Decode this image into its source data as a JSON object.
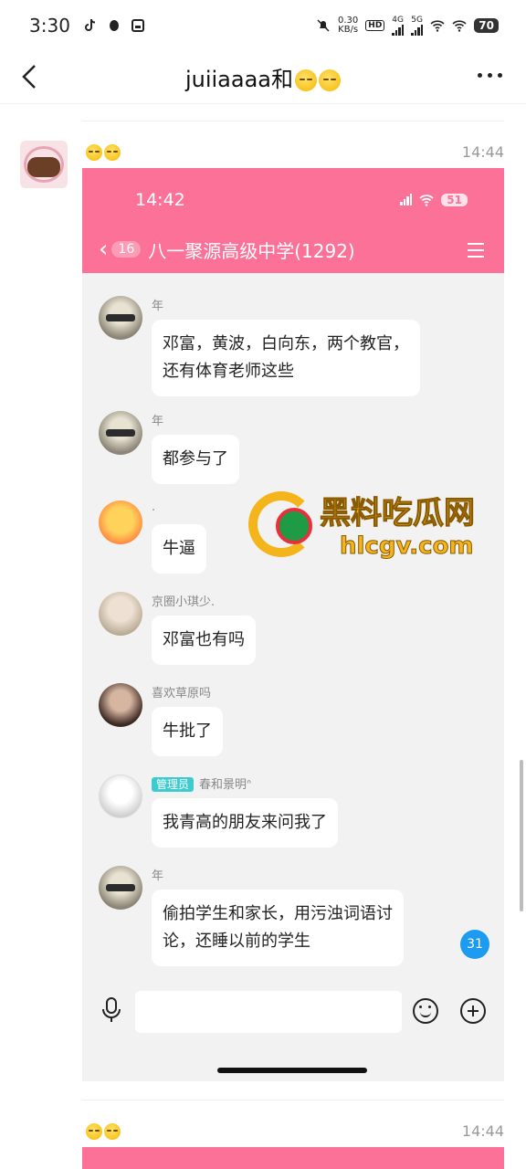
{
  "status_bar": {
    "time": "3:30",
    "net_speed_value": "0.30",
    "net_speed_unit": "KB/s",
    "hd": "HD",
    "sig1": "4G",
    "sig2": "5G",
    "battery": "70"
  },
  "header": {
    "title": "juiiaaaa和"
  },
  "messages": [
    {
      "timestamp": "14:44"
    }
  ],
  "screenshot": {
    "time": "14:42",
    "battery": "51",
    "badge": "16",
    "group_name": "八一聚源高级中学(1292)",
    "chat": [
      {
        "name": "年",
        "text_line1": "邓富，黄波，白向东，两个教官，",
        "text_line2": "还有体育老师这些"
      },
      {
        "name": "年",
        "text_line1": "都参与了"
      },
      {
        "name": ".",
        "text_line1": "牛逼"
      },
      {
        "name": "京圈小琪少.",
        "text_line1": "邓富也有吗"
      },
      {
        "name": "喜欢草原吗",
        "text_line1": "牛批了"
      },
      {
        "role": "管理员",
        "name": "春和景明ᐢ",
        "text_line1": "我青高的朋友来问我了"
      },
      {
        "name": "年",
        "text_line1": "偷拍学生和家长，用污浊词语讨",
        "text_line2": "论，还睡以前的学生"
      }
    ],
    "unread_count": "31"
  },
  "watermark": {
    "title": "黑料吃瓜网",
    "url": "hlcgv.com"
  },
  "next_message": {
    "timestamp": "14:44"
  },
  "colors": {
    "accent": "#fb7198",
    "bubble": "#ffffff",
    "chat_bg": "#f2f2f2"
  }
}
